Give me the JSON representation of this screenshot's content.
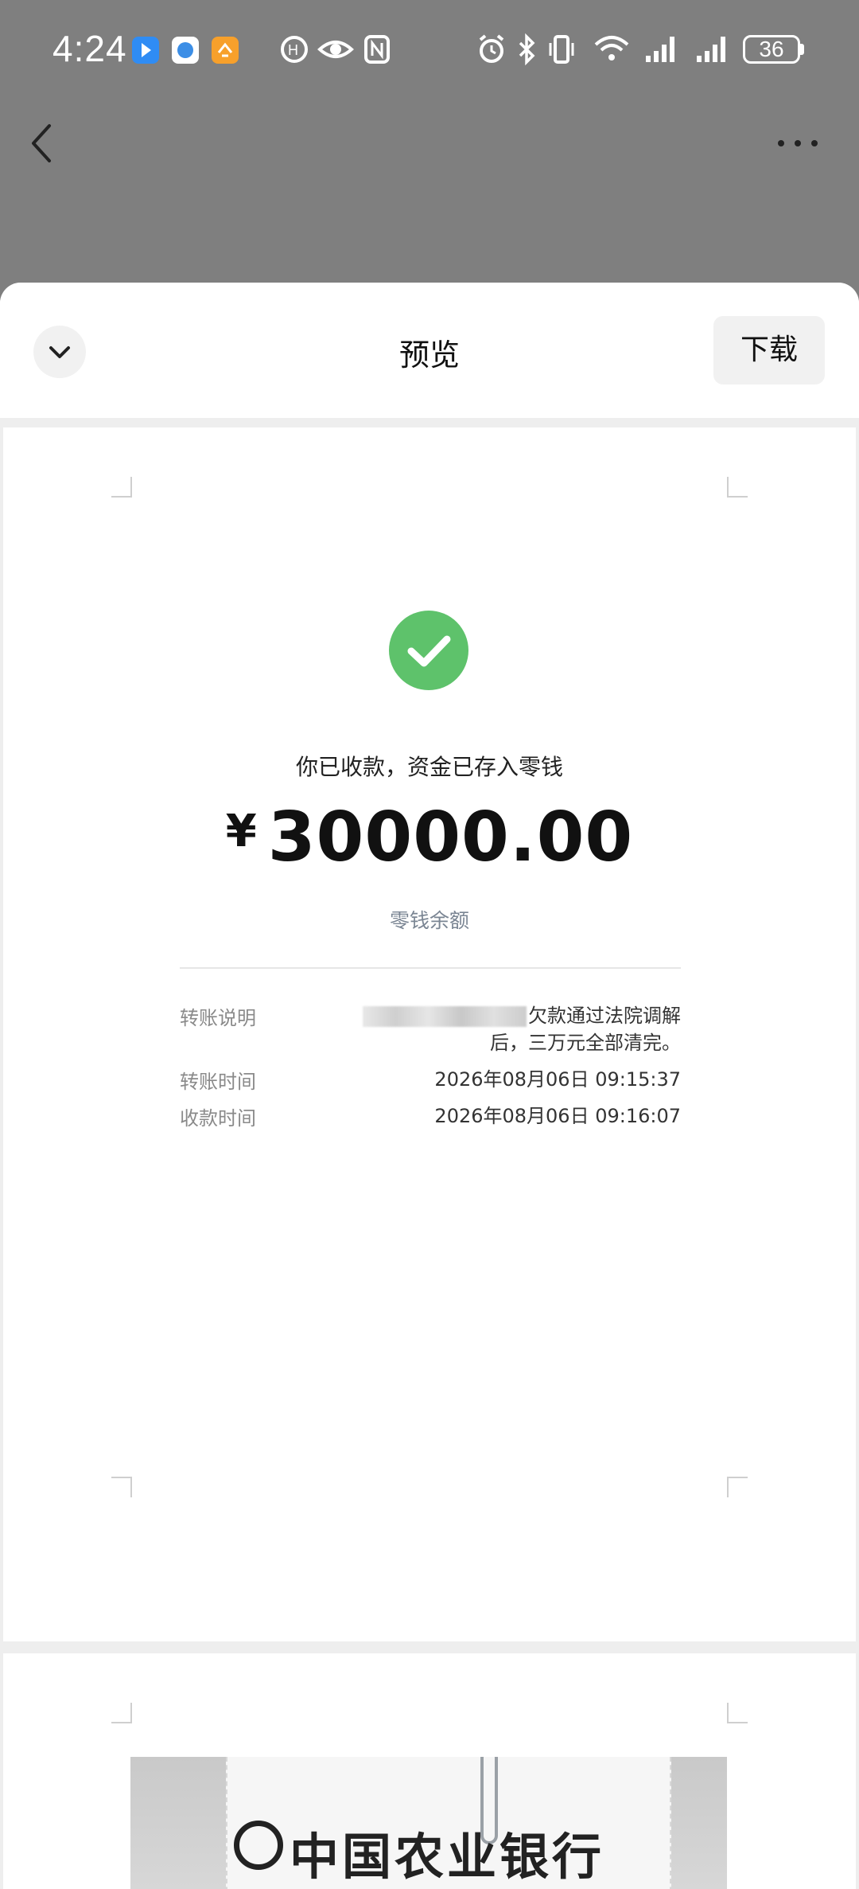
{
  "status_bar": {
    "time": "4:24",
    "battery": "36",
    "icons": [
      "app-notification-icon",
      "app-icon",
      "app-icon",
      "hd-icon",
      "eye-icon",
      "nfc-icon",
      "alarm-icon",
      "bluetooth-icon",
      "vibrate-icon",
      "wifi-icon",
      "signal-icon",
      "signal-icon"
    ]
  },
  "nav": {
    "back_icon": "chevron-left-icon",
    "more_icon": "more-dots-icon"
  },
  "sheet": {
    "title": "预览",
    "download_label": "下载",
    "collapse_icon": "chevron-down-icon"
  },
  "receipt": {
    "status_text": "你已收款，资金已存入零钱",
    "currency": "¥",
    "amount": "30000.00",
    "destination": "零钱余额",
    "details": [
      {
        "label": "转账说明",
        "value_line1": "欠款通过法院调解",
        "value_line2": "后，三万元全部清完。"
      },
      {
        "label": "转账时间",
        "value": "2026年08月06日 09:15:37"
      },
      {
        "label": "收款时间",
        "value": "2026年08月06日 09:16:07"
      }
    ]
  },
  "page2": {
    "bank_name": "中国农业银行"
  },
  "colors": {
    "success": "#5ec26b",
    "overlay": "#7f7f7f",
    "muted": "#7a8593"
  }
}
